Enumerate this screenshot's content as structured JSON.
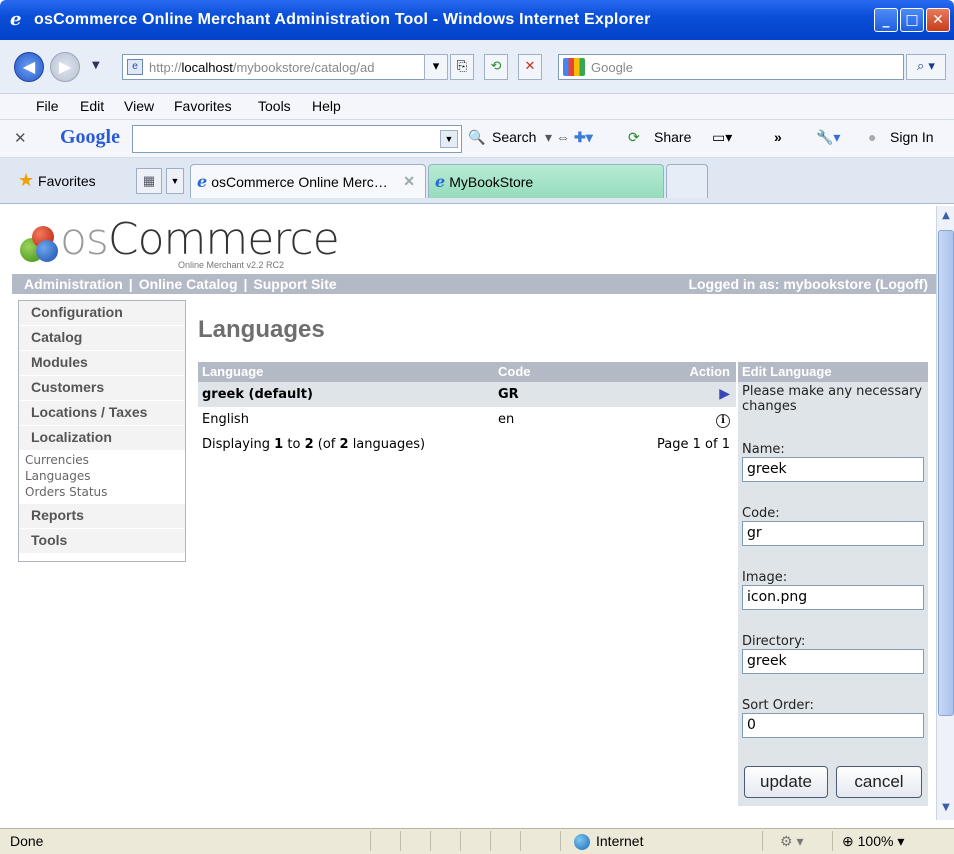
{
  "window": {
    "title": "osCommerce Online Merchant Administration Tool - Windows Internet Explorer"
  },
  "address": {
    "url_prefix": "http://",
    "url_host": "localhost",
    "url_path": "/mybookstore/catalog/ad",
    "search_placeholder": "Google"
  },
  "menu": {
    "items": [
      "File",
      "Edit",
      "View",
      "Favorites",
      "Tools",
      "Help"
    ]
  },
  "google_toolbar": {
    "logo": "Google",
    "search_label": "Search",
    "share_label": "Share",
    "more": "»",
    "signin_label": "Sign In"
  },
  "favorites": {
    "label": "Favorites",
    "tabs": [
      {
        "label": "osCommerce Online Merc…"
      },
      {
        "label": "MyBookStore"
      }
    ]
  },
  "app": {
    "brand_prefix": "os",
    "brand_name": "Commerce",
    "brand_sub": "Online Merchant v2.2 RC2",
    "topnav": [
      "Administration",
      "Online Catalog",
      "Support Site"
    ],
    "logged_in": "Logged in as: mybookstore (Logoff)",
    "sidebar": [
      {
        "label": "Configuration"
      },
      {
        "label": "Catalog"
      },
      {
        "label": "Modules"
      },
      {
        "label": "Customers"
      },
      {
        "label": "Locations / Taxes"
      },
      {
        "label": "Localization",
        "links": [
          "Currencies",
          "Languages",
          "Orders Status"
        ]
      },
      {
        "label": "Reports"
      },
      {
        "label": "Tools"
      }
    ],
    "page_title": "Languages",
    "table": {
      "headers": [
        "Language",
        "Code",
        "Action"
      ],
      "rows": [
        {
          "language": "greek (default)",
          "code": "GR",
          "action_icon": "arrow-right-icon"
        },
        {
          "language": "English",
          "code": "en",
          "action_icon": "info-icon"
        }
      ],
      "footer_displaying_prefix": "Displaying",
      "footer_from": "1",
      "footer_to_word": "to",
      "footer_to": "2",
      "footer_of_prefix": "(of",
      "footer_total": "2",
      "footer_suffix": "languages)",
      "footer_page": "Page 1 of 1"
    },
    "edit": {
      "heading": "Edit Language",
      "intro": "Please make any necessary changes",
      "fields": [
        {
          "label": "Name:",
          "value": "greek"
        },
        {
          "label": "Code:",
          "value": "gr"
        },
        {
          "label": "Image:",
          "value": "icon.png"
        },
        {
          "label": "Directory:",
          "value": "greek"
        },
        {
          "label": "Sort Order:",
          "value": "0"
        }
      ],
      "update_label": "update",
      "cancel_label": "cancel"
    }
  },
  "status": {
    "text": "Done",
    "zone": "Internet",
    "zoom": "100%"
  }
}
